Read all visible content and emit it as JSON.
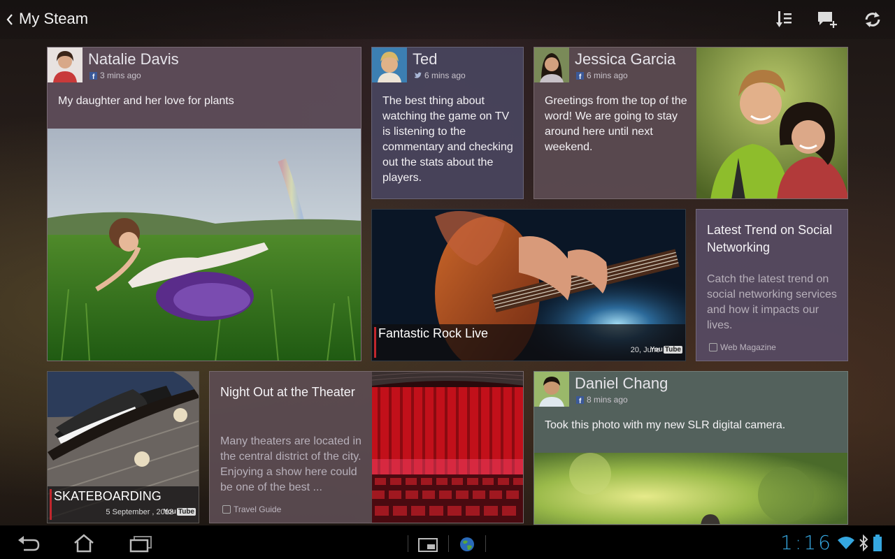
{
  "app": {
    "title": "My Steam"
  },
  "action_bar": {
    "icons": [
      "sort-icon",
      "new-post-icon",
      "refresh-icon"
    ]
  },
  "cards": {
    "natalie": {
      "name": "Natalie Davis",
      "source": "facebook-icon",
      "time": "3 mins ago",
      "text": "My daughter and her love for plants"
    },
    "ted": {
      "name": "Ted",
      "source": "twitter-icon",
      "time": "6 mins ago",
      "text": "The best thing about watching the game on TV is listening to the commentary and checking out the stats about the players."
    },
    "jessica": {
      "name": "Jessica Garcia",
      "source": "facebook-icon",
      "time": "6 mins ago",
      "text": "Greetings from the top of the word!  We are going to stay around here until next weekend."
    },
    "rock": {
      "title": "Fantastic Rock Live",
      "date": "20, June",
      "source": "You Tube"
    },
    "trend": {
      "title": "Latest Trend on Social Networking",
      "body": "Catch the latest trend on social networking services and how it impacts our lives.",
      "source": "Web Magazine"
    },
    "skate": {
      "title": "SKATEBOARDING",
      "date": "5 September , 2012",
      "source": "You Tube"
    },
    "theater": {
      "title": "Night Out at the Theater",
      "body": "Many theaters are located in the central district of the city.  Enjoying a show here could be one of the best ...",
      "source": "Travel Guide"
    },
    "daniel": {
      "name": "Daniel Chang",
      "source": "facebook-icon",
      "time": "8 mins ago",
      "text": "Took this photo with my new SLR digital camera."
    }
  },
  "system_bar": {
    "clock": "1:16",
    "icons": [
      "back-icon",
      "home-icon",
      "recent-apps-icon",
      "screenshot-icon",
      "browser-icon",
      "wifi-icon",
      "bluetooth-icon",
      "battery-icon"
    ]
  },
  "colors": {
    "accent_red": "#c1272d",
    "clock_blue": "#35a7e0"
  }
}
